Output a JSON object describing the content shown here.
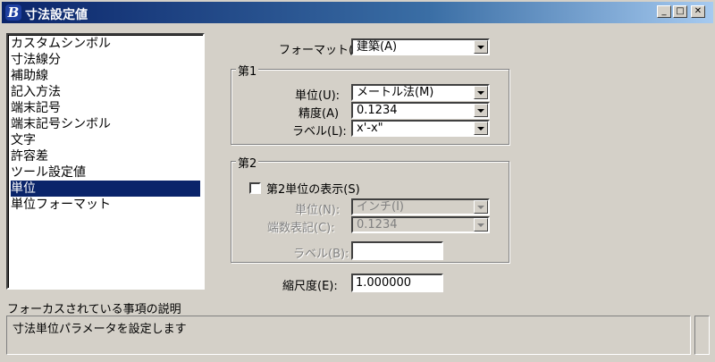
{
  "window": {
    "title": "寸法設定値"
  },
  "categories": {
    "items": [
      "カスタムシンボル",
      "寸法線分",
      "補助線",
      "記入方法",
      "端末記号",
      "端末記号シンボル",
      "文字",
      "許容差",
      "ツール設定値",
      "単位",
      "単位フォーマット"
    ],
    "selected": "単位"
  },
  "format": {
    "label": "フォーマット(F):",
    "value": "建築(A)"
  },
  "group1": {
    "title": "第1",
    "unit": {
      "label": "単位(U):",
      "value": "メートル法(M)"
    },
    "precision": {
      "label": "精度(A)",
      "value": "0.1234"
    },
    "label": {
      "label": "ラベル(L):",
      "value": "x'-x\""
    }
  },
  "group2": {
    "title": "第2",
    "show_checkbox": {
      "label": "第2単位の表示(S)",
      "checked": false
    },
    "unit": {
      "label": "単位(N):",
      "value": "インチ(I)"
    },
    "precision": {
      "label": "端数表記(C):",
      "value": "0.1234"
    },
    "label": {
      "label": "ラベル(B):",
      "value": ""
    }
  },
  "scale": {
    "label": "縮尺度(E):",
    "value": "1.000000"
  },
  "description": {
    "heading": "フォーカスされている事項の説明",
    "text": "寸法単位パラメータを設定します"
  },
  "colors": {
    "titlebar": "#0a246a",
    "selection": "#0a246a",
    "face": "#d4d0c8"
  }
}
